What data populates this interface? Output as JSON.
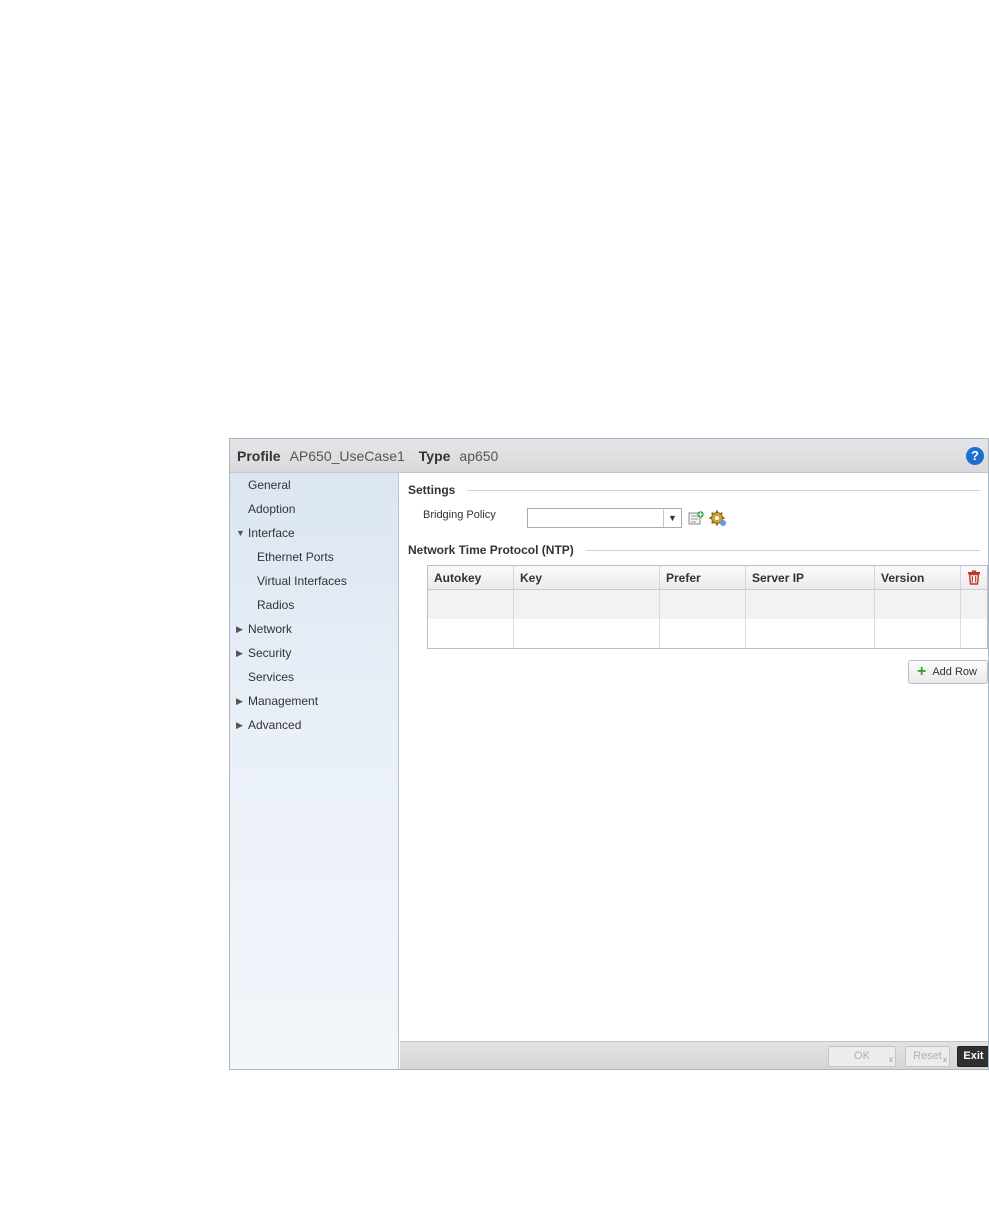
{
  "header": {
    "profile_label": "Profile",
    "profile_value": "AP650_UseCase1",
    "type_label": "Type",
    "type_value": "ap650",
    "help_glyph": "?"
  },
  "sidebar": {
    "items": [
      {
        "label": "General",
        "arrow": "",
        "level": 0
      },
      {
        "label": "Adoption",
        "arrow": "",
        "level": 0
      },
      {
        "label": "Interface",
        "arrow": "▼",
        "level": 0
      },
      {
        "label": "Ethernet Ports",
        "arrow": "",
        "level": 1
      },
      {
        "label": "Virtual Interfaces",
        "arrow": "",
        "level": 1
      },
      {
        "label": "Radios",
        "arrow": "",
        "level": 1
      },
      {
        "label": "Network",
        "arrow": "▶",
        "level": 0
      },
      {
        "label": "Security",
        "arrow": "▶",
        "level": 0
      },
      {
        "label": "Services",
        "arrow": "",
        "level": 0
      },
      {
        "label": "Management",
        "arrow": "▶",
        "level": 0
      },
      {
        "label": "Advanced",
        "arrow": "▶",
        "level": 0
      }
    ]
  },
  "settings": {
    "title": "Settings",
    "bridging_policy_label": "Bridging Policy",
    "bridging_policy_value": "",
    "caret": "▼"
  },
  "ntp": {
    "title": "Network Time Protocol (NTP)",
    "columns": [
      "Autokey",
      "Key",
      "Prefer",
      "Server IP",
      "Version"
    ],
    "rows": [
      [
        "",
        "",
        "",
        "",
        ""
      ],
      [
        "",
        "",
        "",
        "",
        ""
      ]
    ],
    "add_row_label": "Add Row",
    "add_row_icon": "+"
  },
  "footer": {
    "ok_label": "OK",
    "reset_label": "Reset",
    "exit_label": "Exit",
    "clear_mark": "x"
  },
  "colors": {
    "help": "#1f6fd1",
    "trash": "#c0392b",
    "add": "#2ea02e",
    "sidebar": "#dbe6f2"
  }
}
